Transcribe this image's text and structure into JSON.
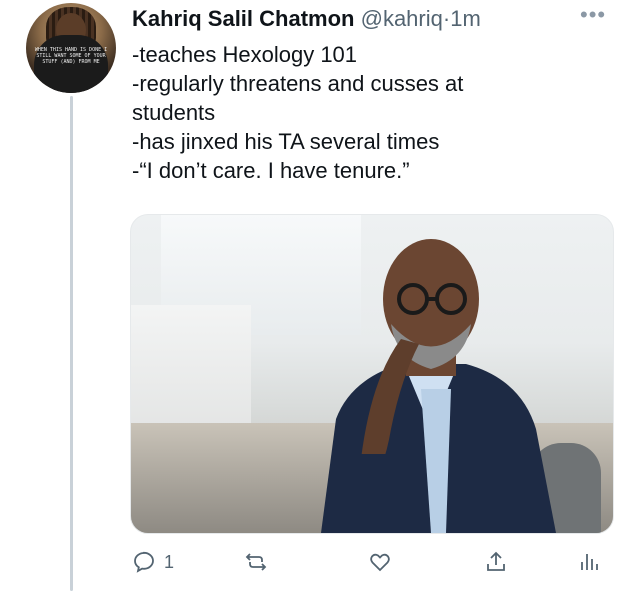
{
  "tweet": {
    "author_name": "Kahriq Salil Chatmon",
    "handle": "@kahriq",
    "separator": "·",
    "time": "1m",
    "more_icon": "more-horizontal-icon",
    "avatar_shirt_text": "WHEN THIS HAND IS DONE I STILL WANT SOME OF YOUR STUFF (AND) FROM ME",
    "lines": [
      "-teaches Hexology 101",
      "-regularly threatens and cusses at",
      "students",
      "-has jinxed his TA several times",
      "-“I don’t care. I have tenure.”"
    ]
  },
  "actions": {
    "reply": {
      "icon": "reply-icon",
      "count": "1"
    },
    "retweet": {
      "icon": "retweet-icon"
    },
    "like": {
      "icon": "heart-icon"
    },
    "share": {
      "icon": "share-icon"
    },
    "analytics": {
      "icon": "analytics-icon"
    }
  },
  "colors": {
    "text": "#0f1419",
    "muted": "#536471",
    "thread_line": "#c9d1d8"
  }
}
